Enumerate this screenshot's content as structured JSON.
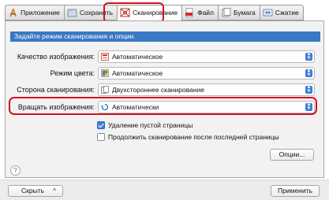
{
  "tabs": [
    {
      "label": "Приложение",
      "icon": "application-icon"
    },
    {
      "label": "Сохранить",
      "icon": "save-folder-icon"
    },
    {
      "label": "Сканирование",
      "icon": "scan-icon",
      "active": true
    },
    {
      "label": "Файл",
      "icon": "pdf-file-icon"
    },
    {
      "label": "Бумага",
      "icon": "paper-icon"
    },
    {
      "label": "Сжатие",
      "icon": "compression-icon"
    }
  ],
  "panel": {
    "title": "Задайте режим сканирования и опции.",
    "rows": [
      {
        "label": "Качество изображения:",
        "value": "Автоматическое"
      },
      {
        "label": "Режим цвета:",
        "value": "Автоматическое"
      },
      {
        "label": "Сторона сканирования:",
        "value": "Двухстороннее сканирование"
      },
      {
        "label": "Вращать изображения:",
        "value": "Автоматически"
      }
    ],
    "checkboxes": [
      {
        "label": "Удаление пустой страницы",
        "checked": true
      },
      {
        "label": "Продолжить сканирование после последней страницы",
        "checked": false
      }
    ],
    "options_button": "Опции...",
    "help": "?"
  },
  "footer": {
    "hide_button": "Скрыть",
    "hide_chevron": "^",
    "apply_button": "Применить"
  },
  "colors": {
    "accent_blue": "#3a78c3",
    "highlight_red": "#d6101e"
  }
}
